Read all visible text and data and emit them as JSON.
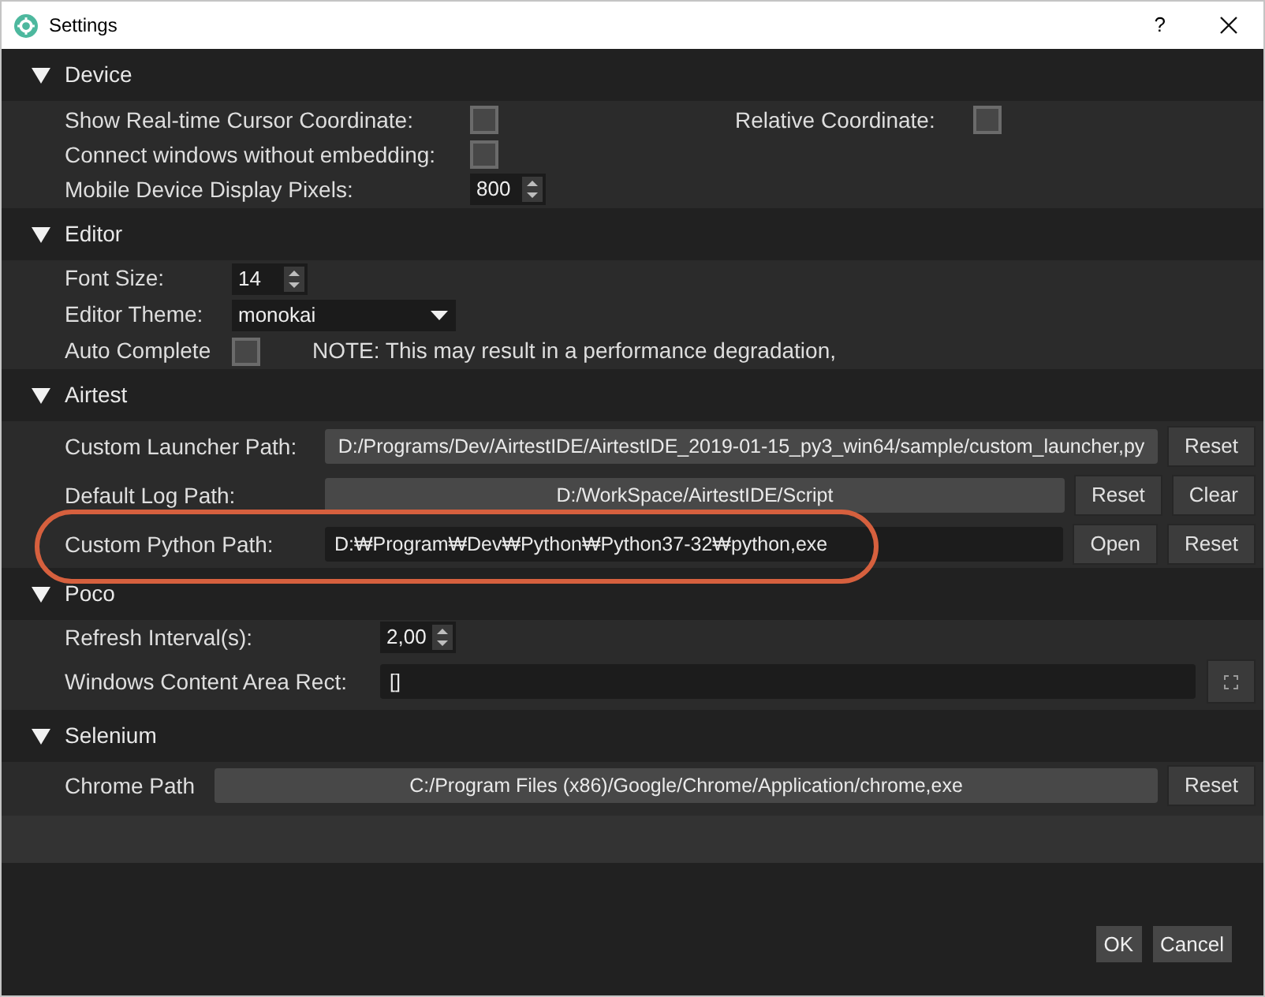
{
  "window": {
    "title": "Settings",
    "help_button": "?"
  },
  "sections": [
    {
      "title": "Device",
      "expanded": true,
      "rows": [
        {
          "label": "Show Real-time Cursor Coordinate:",
          "highlighted": false,
          "controls": [
            {
              "kind": "checkbox",
              "checked": false
            },
            {
              "kind": "label",
              "text": "Relative Coordinate:"
            },
            {
              "kind": "checkbox",
              "checked": false
            }
          ]
        },
        {
          "label": "Connect windows without embedding:",
          "highlighted": false,
          "controls": [
            {
              "kind": "checkbox",
              "checked": false
            }
          ]
        },
        {
          "label": "Mobile Device Display Pixels:",
          "highlighted": false,
          "controls": [
            {
              "kind": "spinbox",
              "value": "800"
            }
          ]
        }
      ]
    },
    {
      "title": "Editor",
      "expanded": true,
      "rows": [
        {
          "label": "Font Size:",
          "highlighted": false,
          "controls": [
            {
              "kind": "spinbox",
              "value": "14"
            }
          ]
        },
        {
          "label": "Editor Theme:",
          "highlighted": false,
          "controls": [
            {
              "kind": "dropdown",
              "value": "monokai"
            }
          ]
        },
        {
          "label": "Auto Complete",
          "highlighted": false,
          "controls": [
            {
              "kind": "checkbox",
              "checked": false
            },
            {
              "kind": "note",
              "text": "NOTE: This may result in a performance degradation,"
            }
          ]
        }
      ]
    },
    {
      "title": "Airtest",
      "expanded": true,
      "rows": [
        {
          "label": "Custom Launcher Path:",
          "highlighted": false,
          "controls": [
            {
              "kind": "field",
              "value": "D:/Programs/Dev/AirtestIDE/AirtestIDE_2019-01-15_py3_win64/sample/custom_launcher,py",
              "readonly": true
            },
            {
              "kind": "button",
              "label": "Reset"
            }
          ]
        },
        {
          "label": "Default Log Path:",
          "highlighted": false,
          "controls": [
            {
              "kind": "field",
              "value": "D:/WorkSpace/AirtestIDE/Script",
              "readonly": true
            },
            {
              "kind": "button",
              "label": "Reset"
            },
            {
              "kind": "button",
              "label": "Clear"
            }
          ]
        },
        {
          "label": "Custom Python Path:",
          "highlighted": true,
          "controls": [
            {
              "kind": "field",
              "value": "D:₩Program₩Dev₩Python₩Python37-32₩python,exe",
              "readonly": false
            },
            {
              "kind": "button",
              "label": "Open"
            },
            {
              "kind": "button",
              "label": "Reset"
            }
          ]
        }
      ]
    },
    {
      "title": "Poco",
      "expanded": true,
      "rows": [
        {
          "label": "Refresh Interval(s):",
          "highlighted": false,
          "controls": [
            {
              "kind": "spinbox",
              "value": "2,00"
            }
          ]
        },
        {
          "label": "Windows Content Area Rect:",
          "highlighted": false,
          "controls": [
            {
              "kind": "field",
              "value": "[]",
              "readonly": false
            },
            {
              "kind": "icon_button"
            }
          ]
        }
      ]
    },
    {
      "title": "Selenium",
      "expanded": true,
      "rows": [
        {
          "label": "Chrome Path",
          "highlighted": false,
          "controls": [
            {
              "kind": "field",
              "value": "C:/Program Files (x86)/Google/Chrome/Application/chrome,exe",
              "readonly": true
            },
            {
              "kind": "button",
              "label": "Reset"
            }
          ]
        }
      ]
    }
  ],
  "footer_buttons": [
    "OK",
    "Cancel"
  ]
}
